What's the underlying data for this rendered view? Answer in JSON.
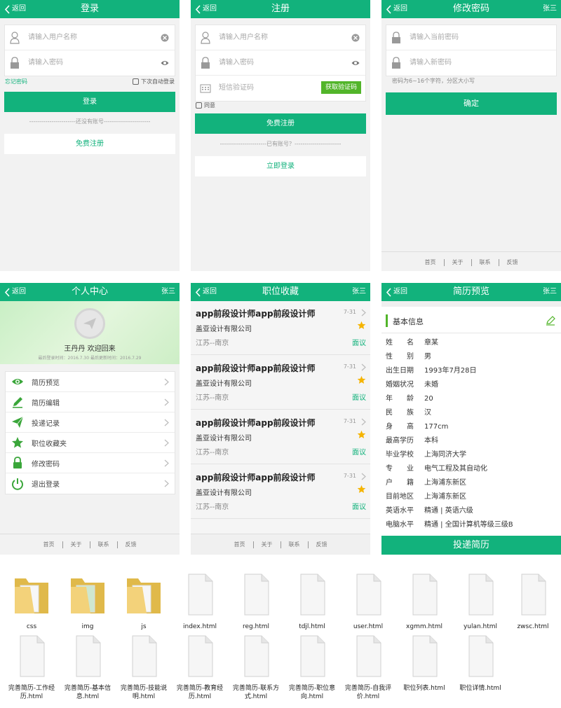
{
  "colors": {
    "accent": "#12b27c",
    "lightgreen": "#8bd45c",
    "star": "#f5b400"
  },
  "back_label": "返回",
  "footer": [
    "首页",
    "关于",
    "联系",
    "反馈"
  ],
  "login": {
    "title": "登录",
    "username_placeholder": "请输入用户名称",
    "password_placeholder": "请输入密码",
    "forgot": "忘记密码",
    "auto_login": "下次自动登录",
    "login_button": "登录",
    "divider": "-----------------------还没有账号-----------------------",
    "register_button": "免费注册"
  },
  "register": {
    "title": "注册",
    "username_placeholder": "请输入用户名称",
    "password_placeholder": "请输入密码",
    "sms_placeholder": "短信验证码",
    "get_code": "获取验证码",
    "agree": "同意",
    "register_button": "免费注册",
    "divider": "-----------------------已有账号？-----------------------",
    "login_button": "立即登录"
  },
  "change_pwd": {
    "title": "修改密码",
    "user": "张三",
    "current_placeholder": "请输入当前密码",
    "new_placeholder": "请输入新密码",
    "hint": "密码为6~16个字符，分区大小写",
    "confirm": "确定"
  },
  "personal": {
    "title": "个人中心",
    "user": "张三",
    "welcome": "王丹丹 欢迎回来",
    "last_login": "最后登录时间：2016.7.30  最后更新时间：2016.7.29",
    "menu": [
      {
        "label": "简历预览",
        "icon": "eye-icon"
      },
      {
        "label": "简历编辑",
        "icon": "pencil-icon"
      },
      {
        "label": "投递记录",
        "icon": "paper-plane-icon"
      },
      {
        "label": "职位收藏夹",
        "icon": "star-icon"
      },
      {
        "label": "修改密码",
        "icon": "lock-icon"
      },
      {
        "label": "退出登录",
        "icon": "power-icon"
      }
    ]
  },
  "favorites": {
    "title": "职位收藏",
    "user": "张三",
    "jobs": [
      {
        "title": "app前段设计师app前段设计师",
        "date": "7-31",
        "company": "盖亚设计有限公司",
        "location": "江苏--南京",
        "salary": "面议"
      },
      {
        "title": "app前段设计师app前段设计师",
        "date": "7-31",
        "company": "盖亚设计有限公司",
        "location": "江苏--南京",
        "salary": "面议"
      },
      {
        "title": "app前段设计师app前段设计师",
        "date": "7-31",
        "company": "盖亚设计有限公司",
        "location": "江苏--南京",
        "salary": "面议"
      },
      {
        "title": "app前段设计师app前段设计师",
        "date": "7-31",
        "company": "盖亚设计有限公司",
        "location": "江苏--南京",
        "salary": "面议"
      }
    ]
  },
  "resume": {
    "title": "简历预览",
    "user": "张三",
    "section": "基本信息",
    "rows": [
      {
        "k": "姓　　名",
        "v": "章某"
      },
      {
        "k": "性　　别",
        "v": "男"
      },
      {
        "k": "出生日期",
        "v": "1993年7月28日"
      },
      {
        "k": "婚姻状况",
        "v": "未婚"
      },
      {
        "k": "年　　龄",
        "v": "20"
      },
      {
        "k": "民　　族",
        "v": "汉"
      },
      {
        "k": "身　　高",
        "v": "177cm"
      },
      {
        "k": "最高学历",
        "v": "本科"
      },
      {
        "k": "毕业学校",
        "v": "上海同济大学"
      },
      {
        "k": "专　　业",
        "v": "电气工程及其自动化"
      },
      {
        "k": "户　　籍",
        "v": "上海浦东新区"
      },
      {
        "k": "目前地区",
        "v": "上海浦东新区"
      },
      {
        "k": "英语水平",
        "v": "精通 | 英语六级"
      },
      {
        "k": "电脑水平",
        "v": "精通 | 全国计算机等级三级B"
      }
    ],
    "submit": "投递简历"
  },
  "files": [
    {
      "name": "css",
      "type": "folder"
    },
    {
      "name": "img",
      "type": "folder"
    },
    {
      "name": "js",
      "type": "folder"
    },
    {
      "name": "index.html",
      "type": "file"
    },
    {
      "name": "reg.html",
      "type": "file"
    },
    {
      "name": "tdjl.html",
      "type": "file"
    },
    {
      "name": "user.html",
      "type": "file"
    },
    {
      "name": "xgmm.html",
      "type": "file"
    },
    {
      "name": "yulan.html",
      "type": "file"
    },
    {
      "name": "zwsc.html",
      "type": "file"
    },
    {
      "name": "完善简历-工作经历.html",
      "type": "file"
    },
    {
      "name": "完善简历-基本信息.html",
      "type": "file"
    },
    {
      "name": "完善简历-技能说明.html",
      "type": "file"
    },
    {
      "name": "完善简历-教育经历.html",
      "type": "file"
    },
    {
      "name": "完善简历-联系方式.html",
      "type": "file"
    },
    {
      "name": "完善简历-职位意向.html",
      "type": "file"
    },
    {
      "name": "完善简历-自我评价.html",
      "type": "file"
    },
    {
      "name": "职位列表.html",
      "type": "file"
    },
    {
      "name": "职位详情.html",
      "type": "file"
    }
  ]
}
